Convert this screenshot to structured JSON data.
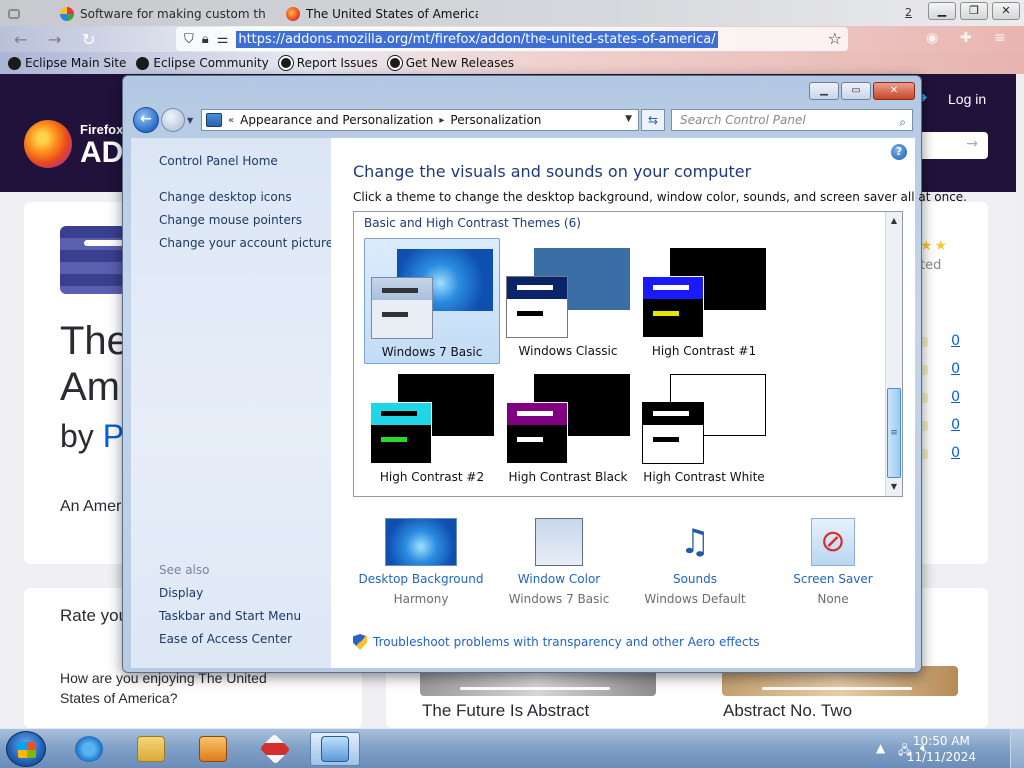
{
  "browser": {
    "tabs": [
      {
        "label": ""
      },
      {
        "label": "Software for making custom th"
      },
      {
        "label": "The United States of America –"
      }
    ],
    "tab_count": "2",
    "url": "https://addons.mozilla.org/mt/firefox/addon/the-united-states-of-america/",
    "bookmarks": [
      "Eclipse Main Site",
      "Eclipse Community",
      "Report Issues",
      "Get New Releases"
    ]
  },
  "site": {
    "logo_small": "Firefox",
    "logo_big": "AD",
    "login": "Log in",
    "title_line1": "The",
    "title_line2": "Am",
    "by": "by",
    "by_author": "P",
    "description": "An Amer",
    "rated": "ted",
    "rating_counts": [
      "0",
      "0",
      "0",
      "0",
      "0"
    ],
    "rate_your": "Rate you",
    "rate_question": "How are you enjoying The United States of America?",
    "recommended": [
      {
        "title": "The Future Is Abstract"
      },
      {
        "title": "Abstract No. Two"
      }
    ]
  },
  "control_panel": {
    "breadcrumb": [
      "Appearance and Personalization",
      "Personalization"
    ],
    "search_placeholder": "Search Control Panel",
    "left_links": [
      "Control Panel Home",
      "Change desktop icons",
      "Change mouse pointers",
      "Change your account picture"
    ],
    "see_also_title": "See also",
    "see_also": [
      "Display",
      "Taskbar and Start Menu",
      "Ease of Access Center"
    ],
    "heading": "Change the visuals and sounds on your computer",
    "subheading": "Click a theme to change the desktop background, window color, sounds, and screen saver all at once.",
    "group_title": "Basic and High Contrast Themes (6)",
    "themes": [
      {
        "name": "Windows 7 Basic",
        "selected": true
      },
      {
        "name": "Windows Classic",
        "selected": false
      },
      {
        "name": "High Contrast #1",
        "selected": false
      },
      {
        "name": "High Contrast #2",
        "selected": false
      },
      {
        "name": "High Contrast Black",
        "selected": false
      },
      {
        "name": "High Contrast White",
        "selected": false
      }
    ],
    "settings": [
      {
        "title": "Desktop Background",
        "value": "Harmony"
      },
      {
        "title": "Window Color",
        "value": "Windows 7 Basic"
      },
      {
        "title": "Sounds",
        "value": "Windows Default"
      },
      {
        "title": "Screen Saver",
        "value": "None"
      }
    ],
    "troubleshoot": "Troubleshoot problems with transparency and other Aero effects"
  },
  "taskbar": {
    "time": "10:50 AM",
    "date": "11/11/2024"
  },
  "colors": {
    "link_blue": "#1f65c4",
    "heading_blue": "#1e3a7b",
    "site_header": "#20123a",
    "selection": "#c2dcf5"
  }
}
